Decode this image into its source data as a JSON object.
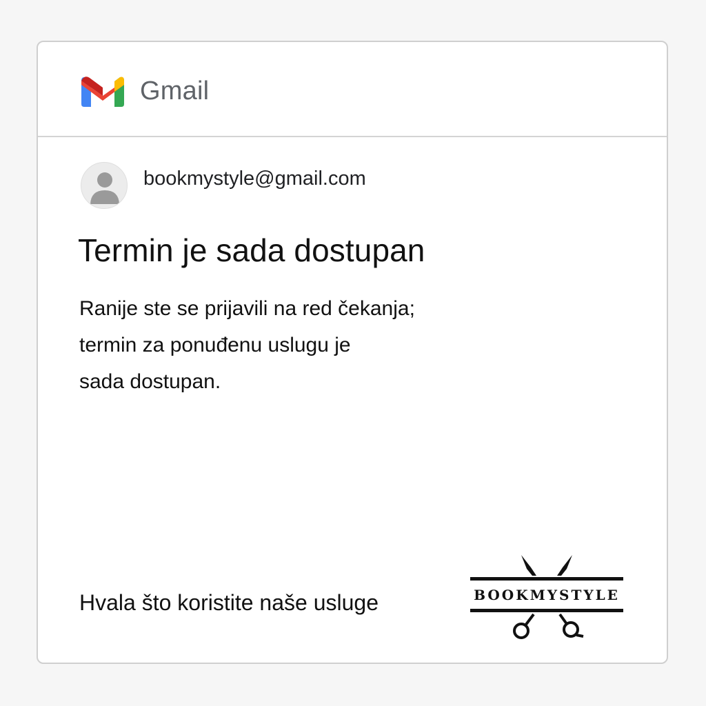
{
  "header": {
    "app_name": "Gmail",
    "logo_icon": "gmail-m-icon",
    "colors": {
      "blue": "#4285F4",
      "red": "#EA4335",
      "yellow": "#FBBC04",
      "green": "#34A853"
    }
  },
  "message": {
    "sender_email": "bookmystyle@gmail.com",
    "avatar_icon": "default-avatar-icon",
    "subject": "Termin je sada dostupan",
    "body_lines": [
      "Ranije ste se prijavili na red čekanja;",
      "termin za ponuđenu uslugu je",
      "sada dostupan."
    ],
    "footer": "Hvala što koristite naše usluge"
  },
  "brand": {
    "name": "BOOKMYSTYLE",
    "icon": "scissors-icon"
  }
}
